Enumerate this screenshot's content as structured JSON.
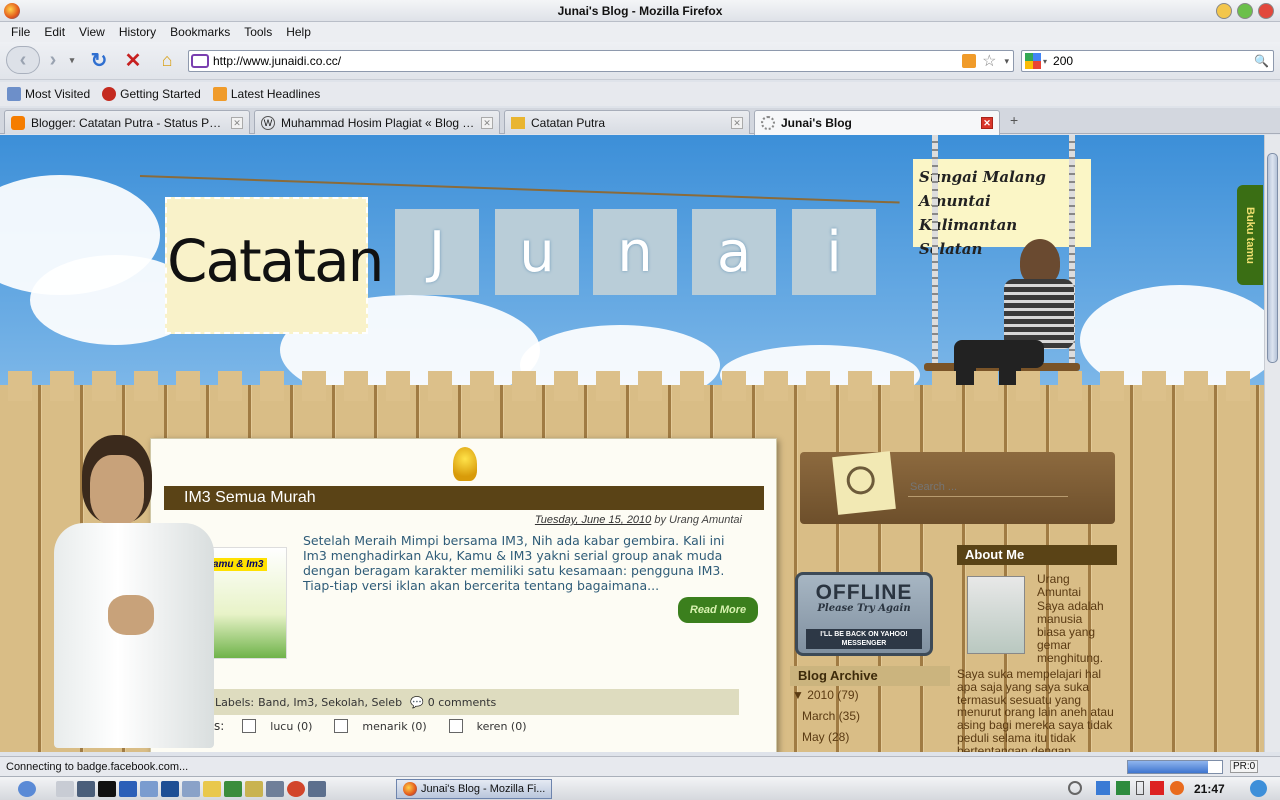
{
  "window": {
    "title": "Junai's Blog - Mozilla Firefox"
  },
  "menu": [
    "File",
    "Edit",
    "View",
    "History",
    "Bookmarks",
    "Tools",
    "Help"
  ],
  "nav": {
    "url": "http://www.junaidi.co.cc/",
    "search_value": "200"
  },
  "bookmarks": [
    "Most Visited",
    "Getting Started",
    "Latest Headlines"
  ],
  "tabs": [
    {
      "label": "Blogger: Catatan Putra - Status Publikasi"
    },
    {
      "label": "Muhammad Hosim Plagiat « Blog Yudi ..."
    },
    {
      "label": "Catatan Putra"
    },
    {
      "label": "Junai's Blog"
    }
  ],
  "header": {
    "catatan": "Catatan",
    "junai_letters": [
      "J",
      "u",
      "n",
      "a",
      "i"
    ],
    "sign_lines": [
      "Sungai Malang",
      "Amuntai",
      "Kalimantan Selatan"
    ],
    "buku_tamu": "Buku tamu"
  },
  "post": {
    "title": "IM3 Semua Murah",
    "date": "Tuesday, June 15, 2010",
    "by": "by Urang Amuntai",
    "body": "Setelah Meraih Mimpi bersama IM3, Nih ada kabar gembira. Kali ini Im3 menghadirkan Aku, Kamu & IM3 yakni serial group anak muda dengan beragam karakter memiliki satu kesamaan: pengguna IM3. Tiap-tiap versi iklan akan bercerita tentang bagaimana...",
    "read_more": "Read More",
    "thumb_brand": "u, Kamu & Im3",
    "labels_prefix": "Labels:",
    "labels": "Band, Im3, Sekolah, Seleb",
    "comments": "0 comments",
    "reactions_label": "tions:",
    "reactions": [
      "lucu (0)",
      "menarik (0)",
      "keren (0)"
    ]
  },
  "sidebar": {
    "search_placeholder": "Search ...",
    "offline": {
      "big": "OFFLINE",
      "sub": "Please Try Again",
      "bar": "I'LL BE BACK ON YAHOO! MESSENGER"
    },
    "blog_archive_title": "Blog Archive",
    "archive": [
      {
        "label": "▼ 2010 (79)"
      },
      {
        "label": "March (35)"
      },
      {
        "label": "May (28)"
      }
    ],
    "about_title": "About Me",
    "about_name": "Urang Amuntai",
    "about_text_right": "Saya adalah manusia biasa yang gemar menghitung.",
    "about_text": "Saya suka mempelajari hal apa saja yang saya suka termasuk sesuatu yang menurut orang lain aneh atau asing bagi mereka saya tidak peduli selama itu tidak bertentangan dengan"
  },
  "status": {
    "text": "Connecting to badge.facebook.com...",
    "pr": "PR:0",
    "progress": 0.85
  },
  "taskbar": {
    "active_item": "Junai's Blog - Mozilla Fi...",
    "clock": "21:47"
  }
}
